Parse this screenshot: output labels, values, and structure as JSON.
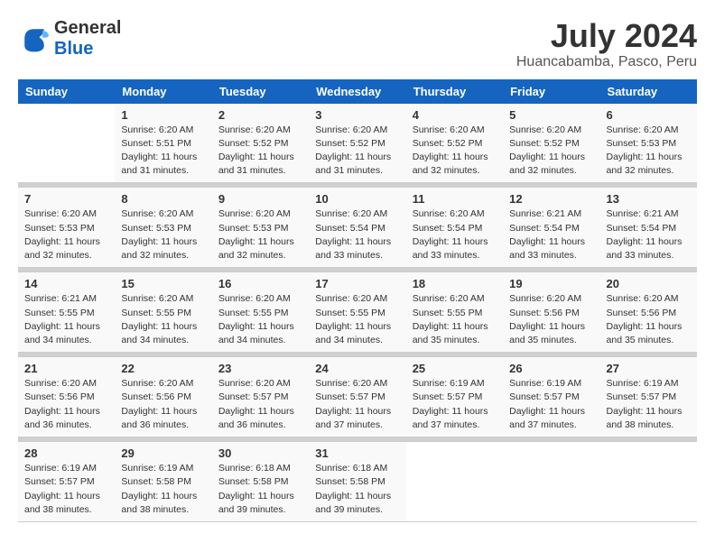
{
  "logo": {
    "text_general": "General",
    "text_blue": "Blue"
  },
  "title": {
    "month_year": "July 2024",
    "location": "Huancabamba, Pasco, Peru"
  },
  "header_days": [
    "Sunday",
    "Monday",
    "Tuesday",
    "Wednesday",
    "Thursday",
    "Friday",
    "Saturday"
  ],
  "weeks": [
    [
      {
        "day": "",
        "info": ""
      },
      {
        "day": "1",
        "info": "Sunrise: 6:20 AM\nSunset: 5:51 PM\nDaylight: 11 hours\nand 31 minutes."
      },
      {
        "day": "2",
        "info": "Sunrise: 6:20 AM\nSunset: 5:52 PM\nDaylight: 11 hours\nand 31 minutes."
      },
      {
        "day": "3",
        "info": "Sunrise: 6:20 AM\nSunset: 5:52 PM\nDaylight: 11 hours\nand 31 minutes."
      },
      {
        "day": "4",
        "info": "Sunrise: 6:20 AM\nSunset: 5:52 PM\nDaylight: 11 hours\nand 32 minutes."
      },
      {
        "day": "5",
        "info": "Sunrise: 6:20 AM\nSunset: 5:52 PM\nDaylight: 11 hours\nand 32 minutes."
      },
      {
        "day": "6",
        "info": "Sunrise: 6:20 AM\nSunset: 5:53 PM\nDaylight: 11 hours\nand 32 minutes."
      }
    ],
    [
      {
        "day": "7",
        "info": "Sunrise: 6:20 AM\nSunset: 5:53 PM\nDaylight: 11 hours\nand 32 minutes."
      },
      {
        "day": "8",
        "info": "Sunrise: 6:20 AM\nSunset: 5:53 PM\nDaylight: 11 hours\nand 32 minutes."
      },
      {
        "day": "9",
        "info": "Sunrise: 6:20 AM\nSunset: 5:53 PM\nDaylight: 11 hours\nand 32 minutes."
      },
      {
        "day": "10",
        "info": "Sunrise: 6:20 AM\nSunset: 5:54 PM\nDaylight: 11 hours\nand 33 minutes."
      },
      {
        "day": "11",
        "info": "Sunrise: 6:20 AM\nSunset: 5:54 PM\nDaylight: 11 hours\nand 33 minutes."
      },
      {
        "day": "12",
        "info": "Sunrise: 6:21 AM\nSunset: 5:54 PM\nDaylight: 11 hours\nand 33 minutes."
      },
      {
        "day": "13",
        "info": "Sunrise: 6:21 AM\nSunset: 5:54 PM\nDaylight: 11 hours\nand 33 minutes."
      }
    ],
    [
      {
        "day": "14",
        "info": "Sunrise: 6:21 AM\nSunset: 5:55 PM\nDaylight: 11 hours\nand 34 minutes."
      },
      {
        "day": "15",
        "info": "Sunrise: 6:20 AM\nSunset: 5:55 PM\nDaylight: 11 hours\nand 34 minutes."
      },
      {
        "day": "16",
        "info": "Sunrise: 6:20 AM\nSunset: 5:55 PM\nDaylight: 11 hours\nand 34 minutes."
      },
      {
        "day": "17",
        "info": "Sunrise: 6:20 AM\nSunset: 5:55 PM\nDaylight: 11 hours\nand 34 minutes."
      },
      {
        "day": "18",
        "info": "Sunrise: 6:20 AM\nSunset: 5:55 PM\nDaylight: 11 hours\nand 35 minutes."
      },
      {
        "day": "19",
        "info": "Sunrise: 6:20 AM\nSunset: 5:56 PM\nDaylight: 11 hours\nand 35 minutes."
      },
      {
        "day": "20",
        "info": "Sunrise: 6:20 AM\nSunset: 5:56 PM\nDaylight: 11 hours\nand 35 minutes."
      }
    ],
    [
      {
        "day": "21",
        "info": "Sunrise: 6:20 AM\nSunset: 5:56 PM\nDaylight: 11 hours\nand 36 minutes."
      },
      {
        "day": "22",
        "info": "Sunrise: 6:20 AM\nSunset: 5:56 PM\nDaylight: 11 hours\nand 36 minutes."
      },
      {
        "day": "23",
        "info": "Sunrise: 6:20 AM\nSunset: 5:57 PM\nDaylight: 11 hours\nand 36 minutes."
      },
      {
        "day": "24",
        "info": "Sunrise: 6:20 AM\nSunset: 5:57 PM\nDaylight: 11 hours\nand 37 minutes."
      },
      {
        "day": "25",
        "info": "Sunrise: 6:19 AM\nSunset: 5:57 PM\nDaylight: 11 hours\nand 37 minutes."
      },
      {
        "day": "26",
        "info": "Sunrise: 6:19 AM\nSunset: 5:57 PM\nDaylight: 11 hours\nand 37 minutes."
      },
      {
        "day": "27",
        "info": "Sunrise: 6:19 AM\nSunset: 5:57 PM\nDaylight: 11 hours\nand 38 minutes."
      }
    ],
    [
      {
        "day": "28",
        "info": "Sunrise: 6:19 AM\nSunset: 5:57 PM\nDaylight: 11 hours\nand 38 minutes."
      },
      {
        "day": "29",
        "info": "Sunrise: 6:19 AM\nSunset: 5:58 PM\nDaylight: 11 hours\nand 38 minutes."
      },
      {
        "day": "30",
        "info": "Sunrise: 6:18 AM\nSunset: 5:58 PM\nDaylight: 11 hours\nand 39 minutes."
      },
      {
        "day": "31",
        "info": "Sunrise: 6:18 AM\nSunset: 5:58 PM\nDaylight: 11 hours\nand 39 minutes."
      },
      {
        "day": "",
        "info": ""
      },
      {
        "day": "",
        "info": ""
      },
      {
        "day": "",
        "info": ""
      }
    ]
  ]
}
